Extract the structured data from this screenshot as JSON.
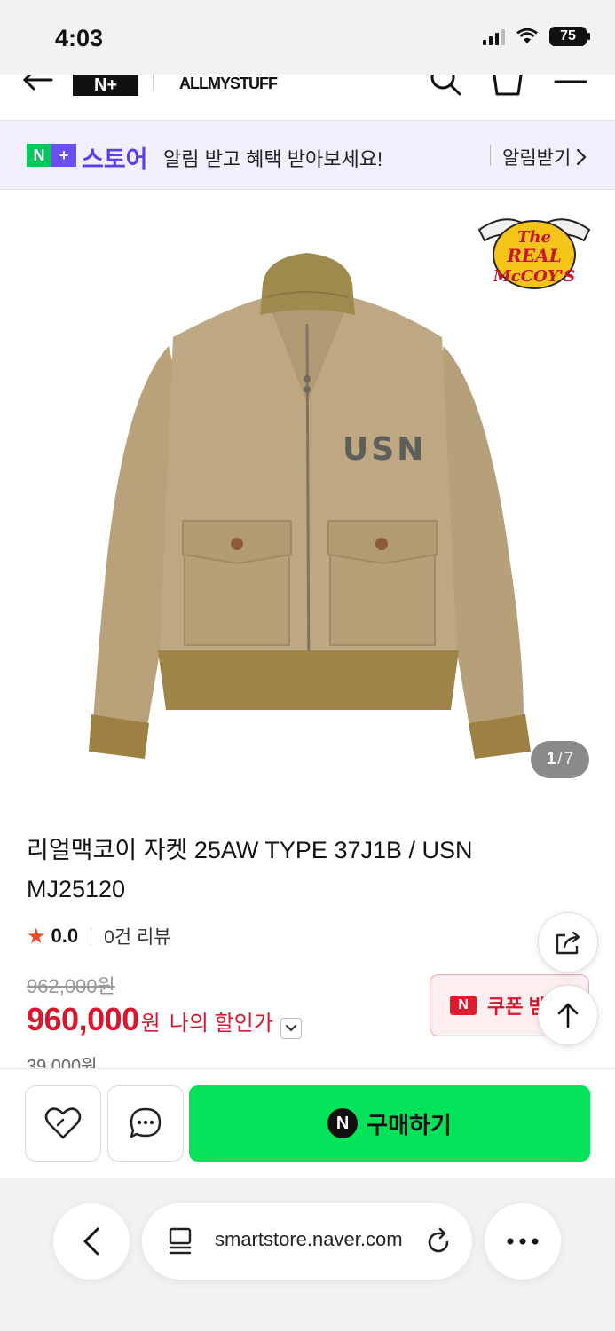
{
  "status_bar": {
    "time": "4:03",
    "battery": "75"
  },
  "header": {
    "logo": "N+",
    "store_name": "ALLMYSTUFF"
  },
  "promo": {
    "badge_n": "N",
    "badge_plus": "+",
    "store_label": "스토어",
    "message": "알림 받고 혜택 받아보세요!",
    "button_label": "알림받기"
  },
  "gallery": {
    "current": "1",
    "separator": "/",
    "total": "7",
    "brand_logo": {
      "line1": "The",
      "line2": "REAL",
      "line3": "McCOY'S"
    },
    "jacket_print": "USN"
  },
  "product": {
    "title": "리얼맥코이 자켓 25AW TYPE 37J1B / USN MJ25120",
    "rating": "0.0",
    "review_count": "0건 리뷰",
    "original_price": "962,000원",
    "sale_price": "960,000",
    "currency": "원",
    "my_discount_label": "나의 할인가",
    "shipping_partial": "39,000원",
    "coupon_badge": "N",
    "coupon_label": "쿠폰 받"
  },
  "actions": {
    "buy_badge": "N",
    "buy_label": "구매하기"
  },
  "browser": {
    "url": "smartstore.naver.com"
  },
  "colors": {
    "accent_green": "#03e35a",
    "price_red": "#d8172f",
    "store_purple": "#5a3ff0"
  }
}
